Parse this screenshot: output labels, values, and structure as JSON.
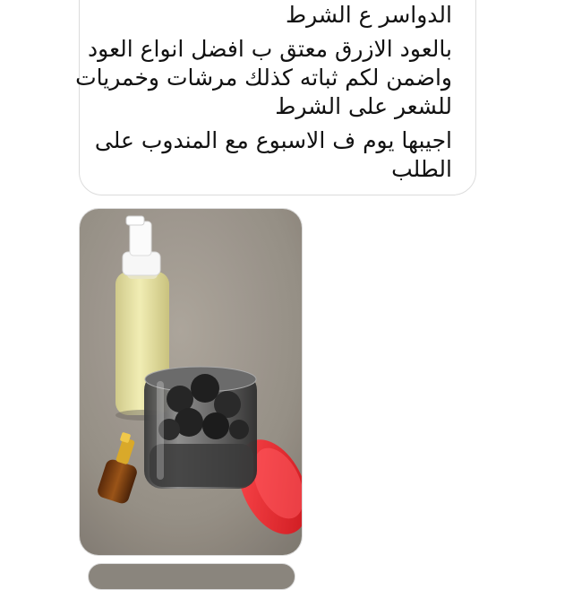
{
  "message": {
    "lines": [
      "الدواسر ع الشرط",
      "بالعود الازرق معتق ب افضل انواع العود",
      "واضمن لكم ثباته كذلك مرشات وخمريات",
      "للشعر على الشرط",
      "اجيبها يوم ف الاسبوع مع المندوب على",
      "الطلب"
    ]
  },
  "attachments": [
    {
      "kind": "photo",
      "content": "spray-bottle-jar-oil-bottle"
    },
    {
      "kind": "photo",
      "content": "partial-next-photo"
    }
  ],
  "colors": {
    "bubble_border": "#dcdcdc",
    "text": "#111111",
    "jar_lid": "#e8242a",
    "lotion": "#e9e4a0"
  }
}
